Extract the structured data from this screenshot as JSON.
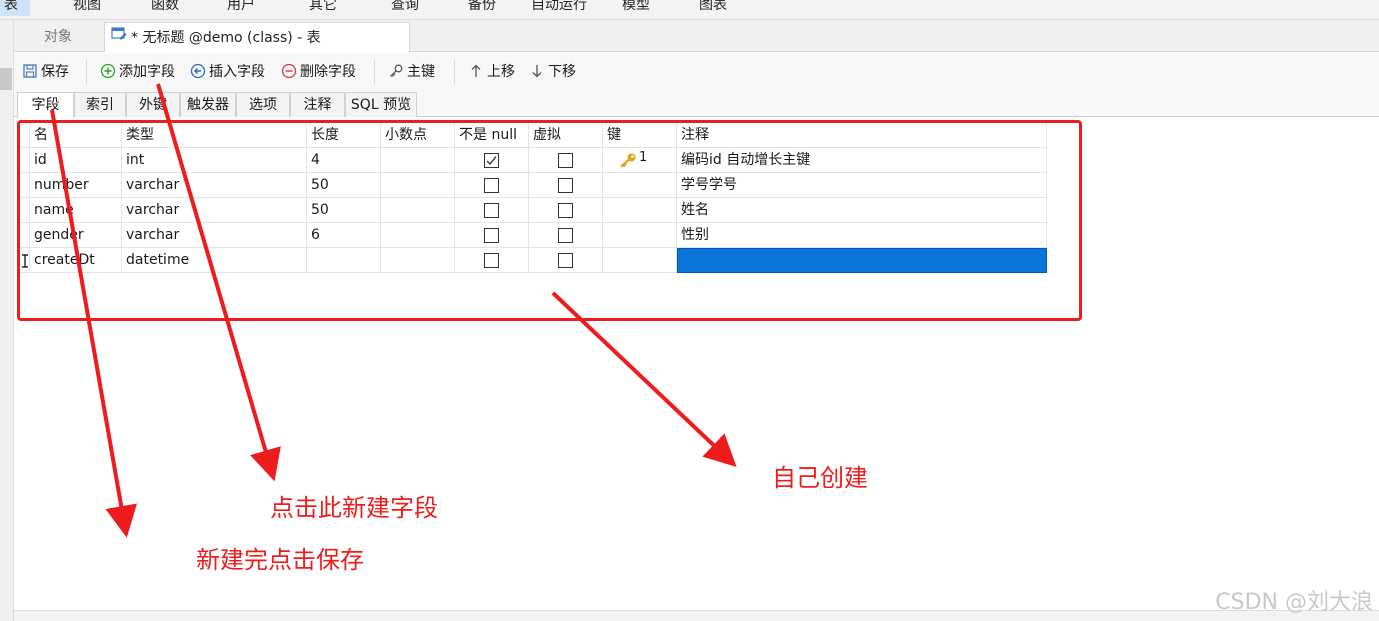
{
  "menu": [
    "表",
    "视图",
    "函数",
    "用户",
    "其它",
    "查询",
    "备份",
    "自动运行",
    "模型",
    "图表"
  ],
  "tabs": {
    "objects": "对象",
    "table": "* 无标题 @demo (class) - 表"
  },
  "toolbar": {
    "save": "保存",
    "add_field": "添加字段",
    "insert_field": "插入字段",
    "delete_field": "删除字段",
    "primary_key": "主键",
    "move_up": "上移",
    "move_down": "下移"
  },
  "subtabs": [
    "字段",
    "索引",
    "外键",
    "触发器",
    "选项",
    "注释",
    "SQL 预览"
  ],
  "grid": {
    "columns": [
      "名",
      "类型",
      "长度",
      "小数点",
      "不是 null",
      "虚拟",
      "键",
      "注释"
    ],
    "rows": [
      {
        "name": "id",
        "type": "int",
        "length": "4",
        "decimal": "",
        "not_null": true,
        "virtual": false,
        "key": "1",
        "comment": "编码id 自动增长主键"
      },
      {
        "name": "number",
        "type": "varchar",
        "length": "50",
        "decimal": "",
        "not_null": false,
        "virtual": false,
        "key": "",
        "comment": "学号学号"
      },
      {
        "name": "name",
        "type": "varchar",
        "length": "50",
        "decimal": "",
        "not_null": false,
        "virtual": false,
        "key": "",
        "comment": "姓名"
      },
      {
        "name": "gender",
        "type": "varchar",
        "length": "6",
        "decimal": "",
        "not_null": false,
        "virtual": false,
        "key": "",
        "comment": "性别"
      },
      {
        "name": "createDt",
        "type": "datetime",
        "length": "",
        "decimal": "",
        "not_null": false,
        "virtual": false,
        "key": "",
        "comment": ""
      }
    ]
  },
  "annotations": {
    "click_new_field": "点击此新建字段",
    "save_after": "新建完点击保存",
    "self_create": "自己创建"
  },
  "watermark": "CSDN @刘大浪",
  "colors": {
    "annotation_red": "#ee1c1c",
    "selection_blue": "#0a74d9",
    "key_gold": "#e2a21b"
  }
}
